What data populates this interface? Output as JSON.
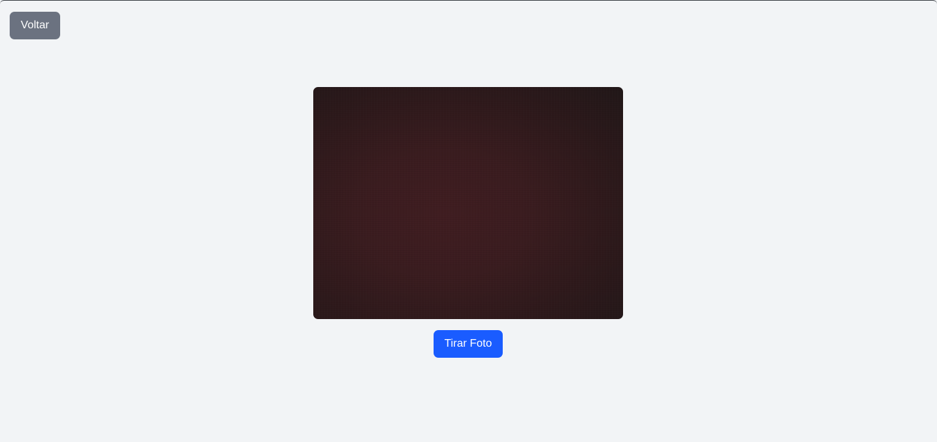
{
  "header": {
    "back_label": "Voltar"
  },
  "camera": {
    "capture_label": "Tirar Foto"
  },
  "colors": {
    "background": "#f2f4f6",
    "back_button": "#6b7280",
    "capture_button": "#1a5cff",
    "preview_dark": "#2e191b"
  }
}
